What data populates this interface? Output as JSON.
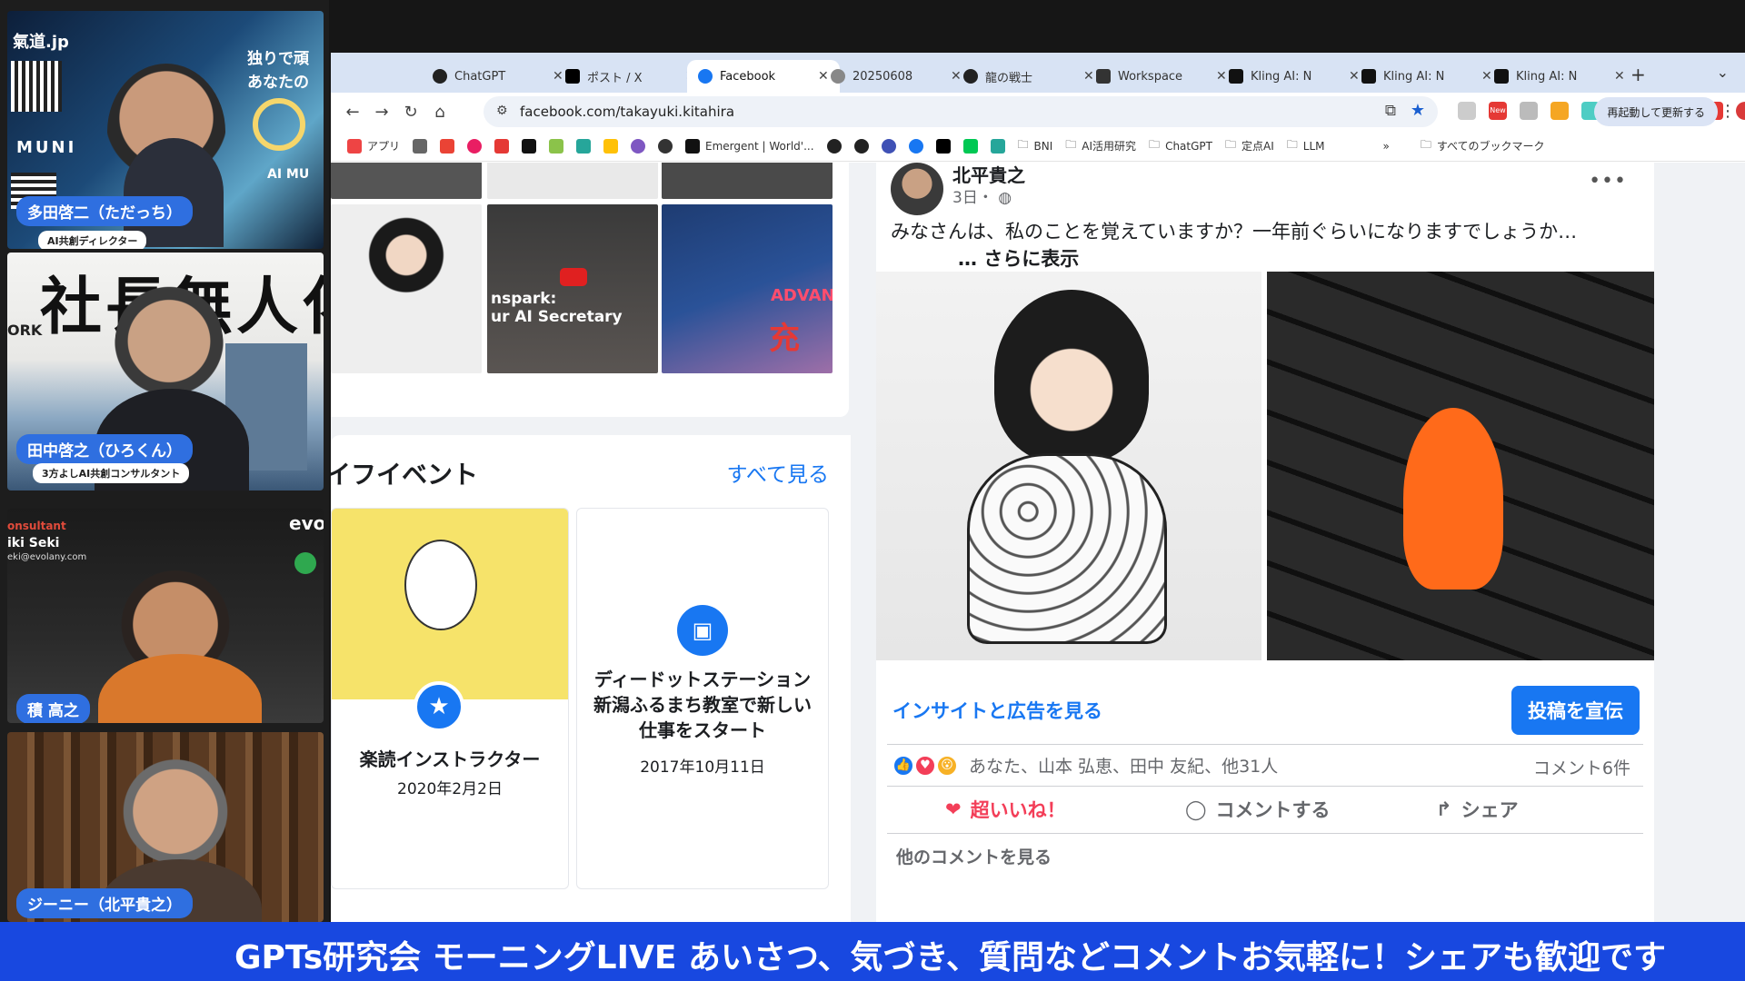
{
  "participants": [
    {
      "name": "多田啓二（ただっち）",
      "role": "AI共創ディレクター",
      "overlay_texts": [
        "氣道.jp",
        "独りで頑",
        "あなたの",
        "MUNI",
        "AI MU"
      ]
    },
    {
      "name": "田中啓之（ひろくん）",
      "role": "3方よしAI共創コンサルタント",
      "overlay_texts": [
        "社長無人化",
        "ORK"
      ]
    },
    {
      "name": "積 高之",
      "role": "",
      "overlay_texts": [
        "onsultant",
        "iki Seki",
        "eki@evolany.com",
        "evo"
      ]
    },
    {
      "name": "ジーニー（北平貴之）",
      "role": "",
      "overlay_texts": []
    }
  ],
  "browser": {
    "tabs": [
      {
        "label": "ChatGPT",
        "active": false
      },
      {
        "label": "ポスト / X",
        "active": false
      },
      {
        "label": "Facebook",
        "active": true
      },
      {
        "label": "20250608",
        "active": false
      },
      {
        "label": "龍の戦士",
        "active": false
      },
      {
        "label": "Workspace",
        "active": false
      },
      {
        "label": "Kling AI: N",
        "active": false
      },
      {
        "label": "Kling AI: N",
        "active": false
      },
      {
        "label": "Kling AI: N",
        "active": false
      }
    ],
    "new_tab": "+",
    "url": "facebook.com/takayuki.kitahira",
    "restart_label": "再起動して更新する",
    "ext_badge": "New",
    "bookmarks": [
      {
        "label": "アプリ"
      },
      {
        "label": "Emergent | World'..."
      },
      {
        "label": "BNI"
      },
      {
        "label": "AI活用研究"
      },
      {
        "label": "ChatGPT"
      },
      {
        "label": "定点AI"
      },
      {
        "label": "LLM"
      }
    ],
    "bookmarks_more": "»",
    "all_bookmarks": "すべてのブックマーク"
  },
  "left": {
    "thumb_texts": {
      "youtube_text": "nspark:\nur AI Secretary",
      "advan_text": "ADVAN",
      "advan_sub": "充"
    },
    "life_events_title": "イフイベント",
    "see_all": "すべて見る",
    "events": [
      {
        "title": "楽読インストラクター",
        "date": "2020年2月2日"
      },
      {
        "title": "ディードットステーション新潟ふるまち教室で新しい仕事をスタート",
        "date": "2017年10月11日"
      }
    ]
  },
  "post": {
    "author": "北平貴之",
    "time": "3日・",
    "text": "みなさんは、私のことを覚えていますか？一年前ぐらいになりますでしょうか…",
    "see_more": "… さらに表示",
    "insights": "インサイトと広告を見る",
    "promote": "投稿を宣伝",
    "reactions_text": "あなた、山本 弘恵、田中 友紀、他31人",
    "comments": "コメント6件",
    "actions": {
      "love": "超いいね！",
      "comment": "コメントする",
      "share": "シェア"
    },
    "other_comments": "他のコメントを見る"
  },
  "ticker": "GPTs研究会 モーニングLIVE あいさつ、気づき、質問などコメントお気軽に！シェアも歓迎です",
  "colors": {
    "facebook_blue": "#1877f2",
    "ticker_blue": "#1848e0",
    "name_tag_blue": "#2f6fe0",
    "love_red": "#f33e58"
  }
}
